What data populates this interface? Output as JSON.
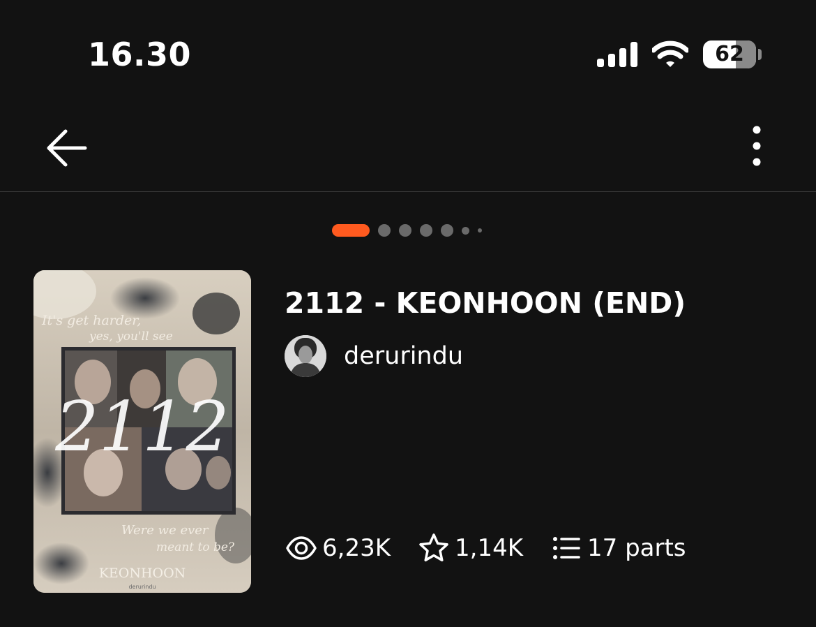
{
  "status_bar": {
    "time": "16.30",
    "battery_level": "62",
    "battery_fraction": 0.62
  },
  "app_bar": {
    "back_icon": "arrow-left-icon",
    "more_icon": "more-vertical-icon"
  },
  "pager": {
    "count": 7,
    "active_index": 0,
    "colors": {
      "active": "#ff5a1f",
      "inactive": "#6a6a6a"
    }
  },
  "story": {
    "title": "2112 - KEONHOON (END)",
    "author": "derurindu",
    "cover_text": {
      "top_line_1": "It's get harder,",
      "top_line_2": "yes, you'll see",
      "big_number": "2112",
      "bottom_line_1": "Were we ever",
      "bottom_line_2": "meant to be?",
      "name": "KEONHOON",
      "credit": "derurindu"
    },
    "stats": {
      "reads": "6,23K",
      "votes": "1,14K",
      "parts": "17 parts"
    }
  }
}
